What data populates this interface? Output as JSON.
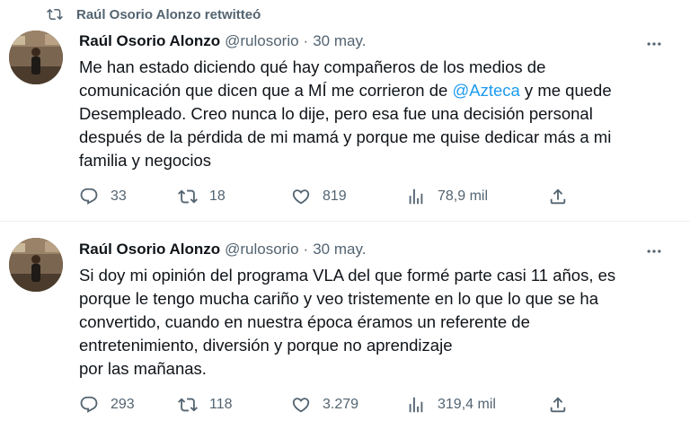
{
  "retweet_banner": "Raúl Osorio Alonzo retwitteó",
  "tweets": [
    {
      "name": "Raúl Osorio Alonzo",
      "handle": "@rulosorio",
      "separator": "·",
      "date": "30 may.",
      "lines": [
        [
          "Me han estado diciendo qué hay compañeros de los medios de"
        ],
        [
          "comunicación que dicen que a MÍ me corrieron de ",
          "@Azteca",
          " y me quede"
        ],
        [
          "Desempleado. Creo nunca lo dije, pero esa fue una decisión personal"
        ],
        [
          "después de la pérdida de mi mamá y porque me quise dedicar más a mi"
        ],
        [
          "familia y negocios"
        ]
      ],
      "replies": "33",
      "retweets": "18",
      "likes": "819",
      "views": "78,9 mil"
    },
    {
      "name": "Raúl Osorio Alonzo",
      "handle": "@rulosorio",
      "separator": "·",
      "date": "30 may.",
      "lines": [
        [
          "Si doy mi opinión del programa VLA del que formé parte casi 11 años, es"
        ],
        [
          "porque le tengo mucha cariño y veo tristemente en lo que lo que se ha"
        ],
        [
          "convertido, cuando en nuestra época éramos un referente de"
        ],
        [
          "entretenimiento, diversión y porque no aprendizaje"
        ],
        [
          "por las mañanas."
        ]
      ],
      "replies": "293",
      "retweets": "118",
      "likes": "3.279",
      "views": "319,4 mil"
    }
  ],
  "icons": {
    "retweet": "retweet-icon",
    "reply": "reply-icon",
    "like": "heart-icon",
    "views": "views-bar-chart-icon",
    "share": "share-icon",
    "more": "more-dots-icon"
  },
  "colors": {
    "text": "#0f1419",
    "secondary": "#536471",
    "mention": "#1d9bf0",
    "divider": "#eff3f4"
  }
}
